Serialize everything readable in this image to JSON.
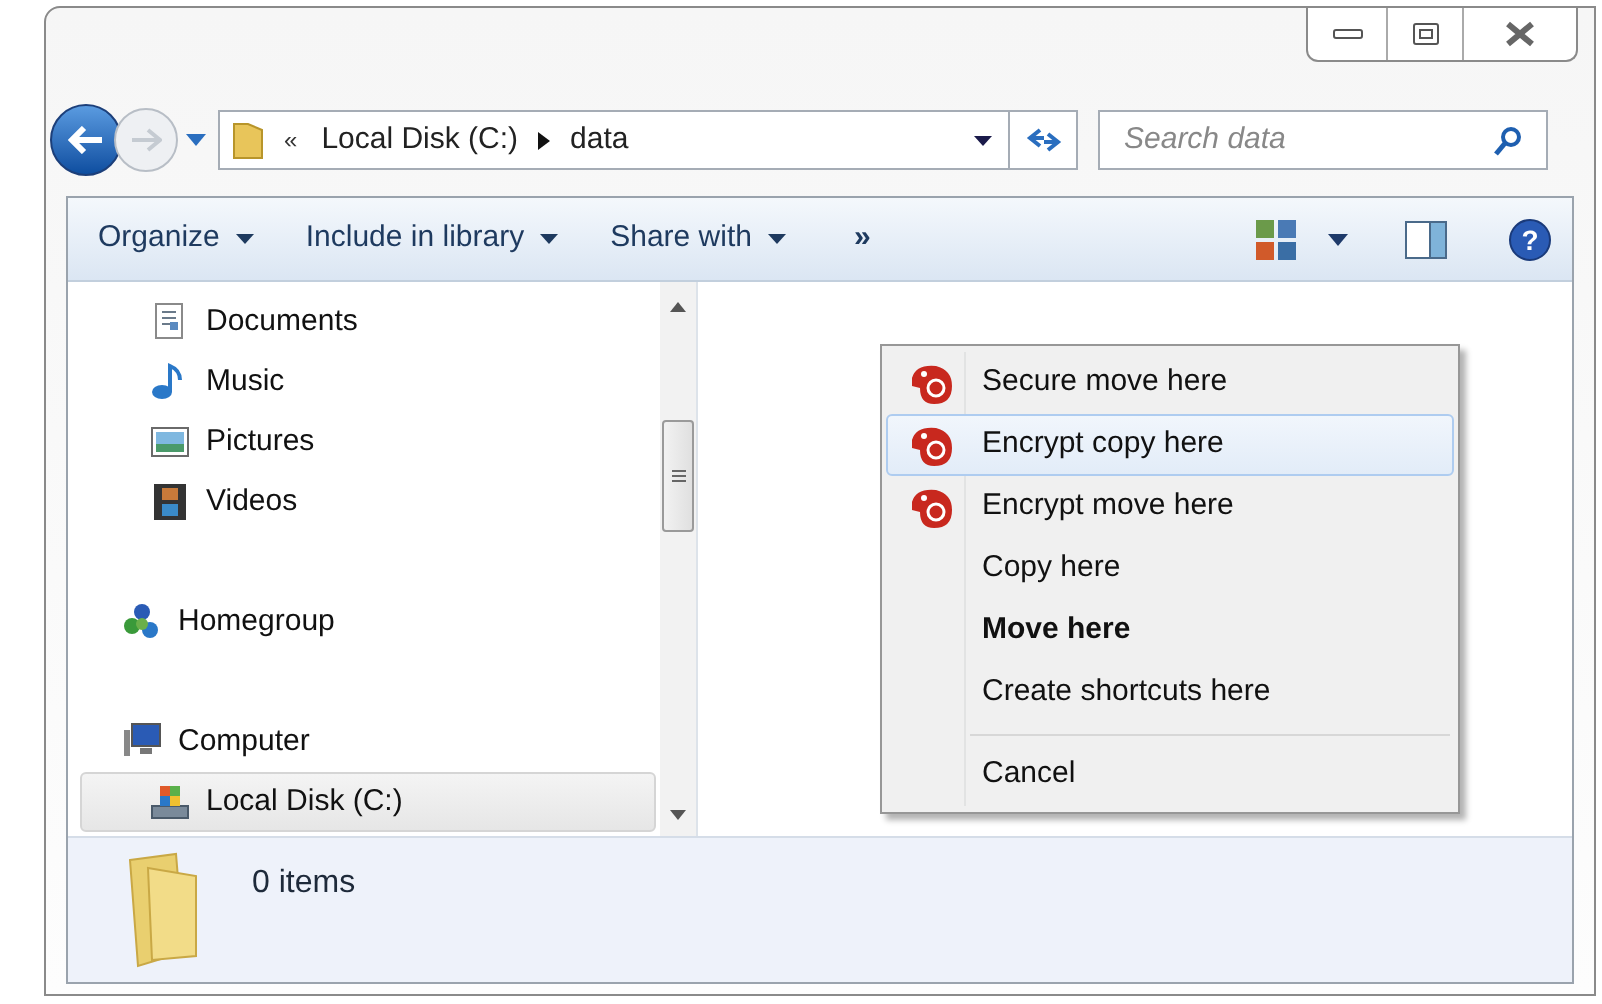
{
  "address_bar": {
    "overflow": "«",
    "segments": [
      "Local Disk (C:)",
      "data"
    ]
  },
  "search": {
    "placeholder": "Search data"
  },
  "toolbar": {
    "items": [
      "Organize",
      "Include in library",
      "Share with"
    ],
    "more": "»",
    "help": "?"
  },
  "navigation": [
    {
      "label": "Documents",
      "selected": false
    },
    {
      "label": "Music",
      "selected": false
    },
    {
      "label": "Pictures",
      "selected": false
    },
    {
      "label": "Videos",
      "selected": false
    },
    {
      "label": "Homegroup",
      "selected": false
    },
    {
      "label": "Computer",
      "selected": false
    },
    {
      "label": "Local Disk (C:)",
      "selected": true
    }
  ],
  "context_menu": [
    {
      "label": "Secure move here",
      "icon": true,
      "bold": false,
      "selected": false
    },
    {
      "label": "Encrypt copy here",
      "icon": true,
      "bold": false,
      "selected": true
    },
    {
      "label": "Encrypt move here",
      "icon": true,
      "bold": false,
      "selected": false
    },
    {
      "label": "Copy here",
      "icon": false,
      "bold": false,
      "selected": false
    },
    {
      "label": "Move here",
      "icon": false,
      "bold": true,
      "selected": false
    },
    {
      "label": "Create shortcuts here",
      "icon": false,
      "bold": false,
      "selected": false
    },
    {
      "label": "Cancel",
      "icon": false,
      "bold": false,
      "selected": false,
      "separator_before": true
    }
  ],
  "details": {
    "count": "0 items"
  }
}
